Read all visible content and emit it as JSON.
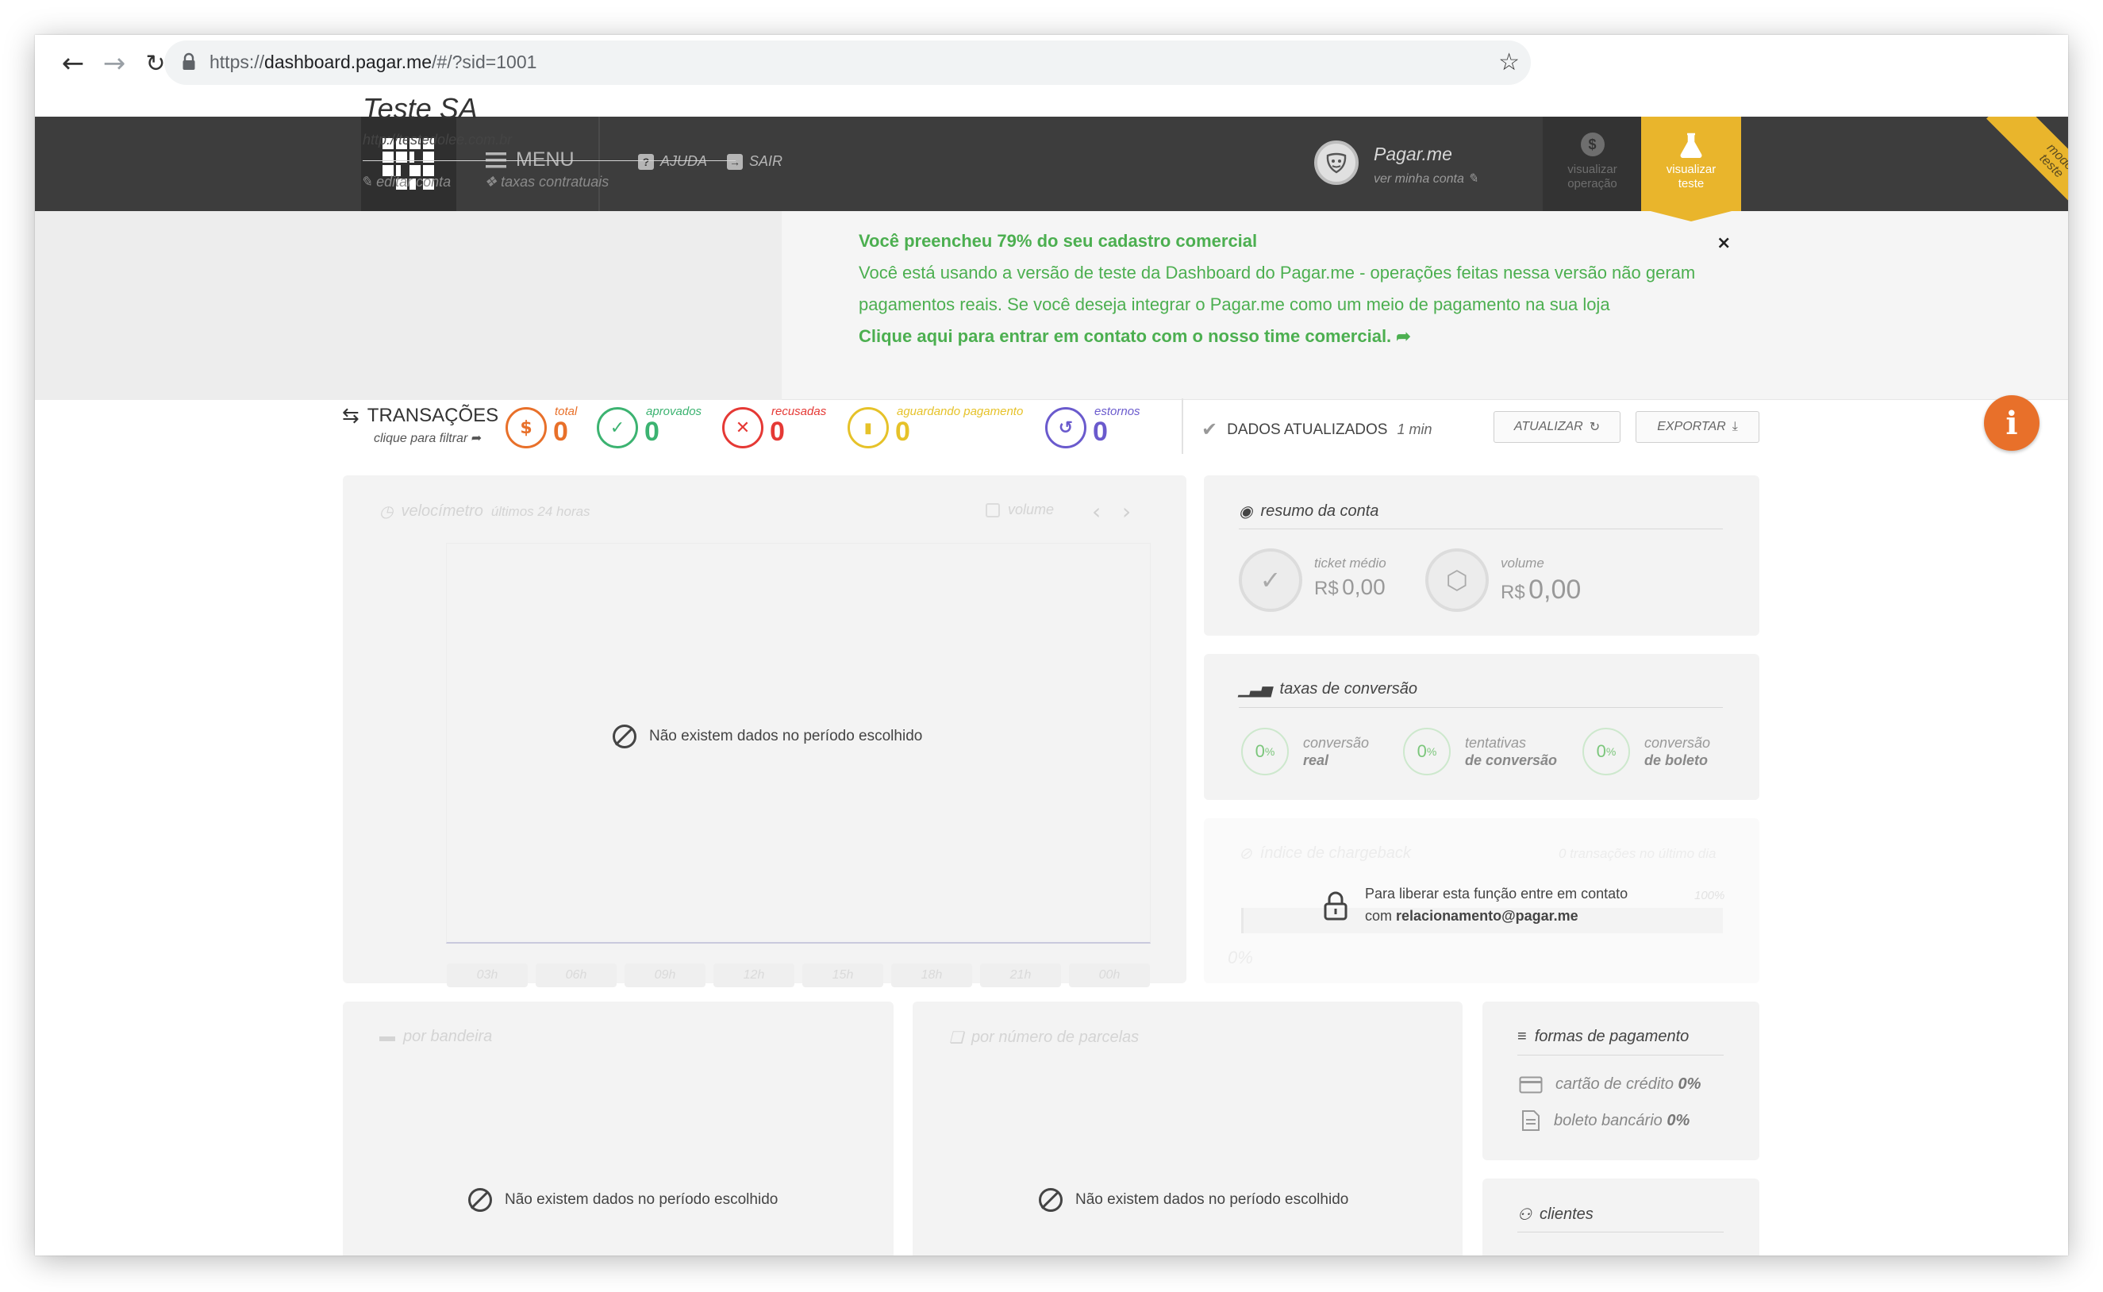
{
  "browser": {
    "url_scheme": "https://",
    "url_host": "dashboard.pagar.me",
    "url_rest": "/#/?sid=1001"
  },
  "header": {
    "menu_label": "MENU",
    "help_label": "AJUDA",
    "exit_label": "SAIR",
    "account_name": "Pagar.me",
    "account_sub": "ver minha conta",
    "view_operation": [
      "visualizar",
      "operação"
    ],
    "view_test": [
      "visualizar",
      "teste"
    ],
    "ribbon": "modo teste"
  },
  "account": {
    "company": "Teste SA",
    "url": "http://testedolee.com.br",
    "edit_label": "editar conta",
    "fees_label": "taxas contratuais"
  },
  "notice": {
    "headline": "Você preencheu 79% do seu cadastro comercial",
    "line1": "Você está usando a versão de teste da Dashboard do Pagar.me - operações feitas nessa versão não geram",
    "line2": "pagamentos reais. Se você deseja integrar o Pagar.me como um meio de pagamento na sua loja",
    "cta": "Clique aqui para entrar em contato com o nosso time comercial.",
    "close": "×"
  },
  "transactions": {
    "title": "TRANSAÇÕES",
    "subtitle": "clique para filtrar",
    "stats": [
      {
        "label": "total",
        "value": "0",
        "color": "#e8702a"
      },
      {
        "label": "aprovados",
        "value": "0",
        "color": "#3cb371"
      },
      {
        "label": "recusadas",
        "value": "0",
        "color": "#e53935"
      },
      {
        "label": "aguardando pagamento",
        "value": "0",
        "color": "#e6c229"
      },
      {
        "label": "estornos",
        "value": "0",
        "color": "#6a5acd"
      }
    ],
    "updated_label": "DADOS ATUALIZADOS",
    "updated_ago": "1 min",
    "refresh_label": "ATUALIZAR",
    "export_label": "EXPORTAR"
  },
  "speedometer": {
    "title": "velocímetro",
    "period": "últimos 24 horas",
    "volume_label": "volume",
    "no_data": "Não existem dados no período escolhido",
    "ticks": [
      "03h",
      "06h",
      "09h",
      "12h",
      "15h",
      "18h",
      "21h",
      "00h"
    ]
  },
  "summary": {
    "title": "resumo da conta",
    "ticket_label": "ticket médio",
    "ticket_currency": "R$",
    "ticket_value": "0,00",
    "volume_label": "volume",
    "volume_currency": "R$",
    "volume_value": "0,00"
  },
  "conversion": {
    "title": "taxas de conversão",
    "items": [
      {
        "value": "0",
        "unit": "%",
        "line1": "conversão",
        "line2": "real"
      },
      {
        "value": "0",
        "unit": "%",
        "line1": "tentativas",
        "line2": "de conversão"
      },
      {
        "value": "0",
        "unit": "%",
        "line1": "conversão",
        "line2": "de boleto"
      }
    ]
  },
  "chargeback": {
    "title": "índice de chargeback",
    "right": "0 transações no último dia",
    "pct_right": "100%",
    "pct_left": "0%",
    "lock_line1": "Para liberar esta função entre em contato",
    "lock_line2_prefix": "com",
    "lock_email": "relacionamento@pagar.me"
  },
  "brand": {
    "title": "por bandeira",
    "no_data": "Não existem dados no período escolhido"
  },
  "installments": {
    "title": "por número de parcelas",
    "no_data": "Não existem dados no período escolhido"
  },
  "payment_methods": {
    "title": "formas de pagamento",
    "card_label": "cartão de crédito",
    "card_value": "0%",
    "boleto_label": "boleto bancário",
    "boleto_value": "0%"
  },
  "clients": {
    "title": "clientes"
  }
}
